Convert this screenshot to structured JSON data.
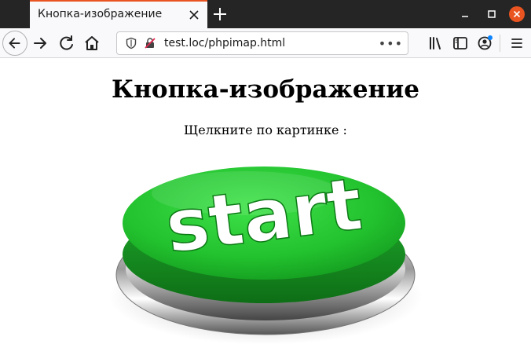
{
  "browser": {
    "tab": {
      "title": "Кнопка-изображение"
    },
    "url": "test.loc/phpimap.html",
    "page_actions": "•••"
  },
  "page": {
    "heading": "Кнопка-изображение",
    "instruction": "Щелкните по картинке :",
    "image_button": {
      "label": "start",
      "button_color": "#22c12e",
      "ring_color": "#c0c0c0"
    }
  },
  "colors": {
    "tabstrip": "#252525",
    "accent": "#e95420",
    "toolbar": "#f9f9fb"
  }
}
